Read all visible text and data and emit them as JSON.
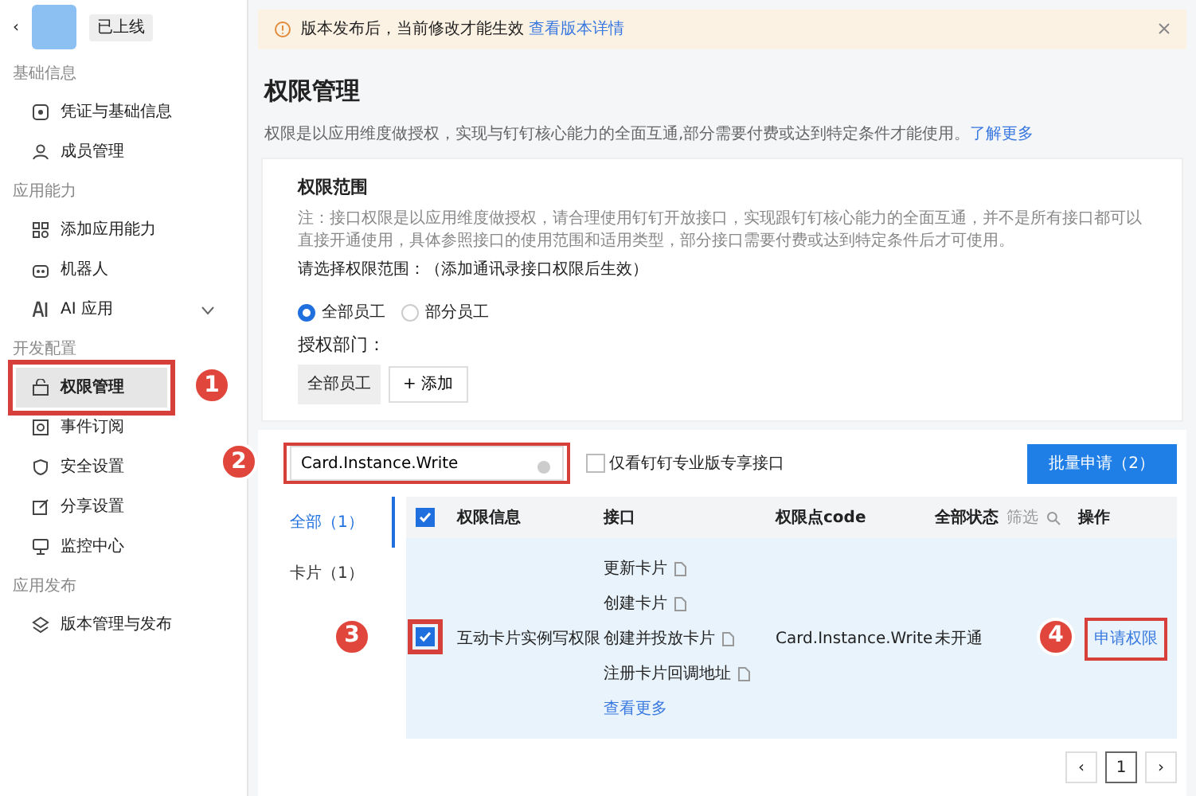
{
  "header": {
    "back": "‹",
    "status": "已上线"
  },
  "sidebar": {
    "sections": [
      {
        "title": "基础信息",
        "items": [
          {
            "label": "凭证与基础信息",
            "selected": false
          },
          {
            "label": "成员管理",
            "selected": false
          }
        ]
      },
      {
        "title": "应用能力",
        "items": [
          {
            "label": "添加应用能力",
            "selected": false
          },
          {
            "label": "机器人",
            "selected": false
          },
          {
            "label": "AI 应用",
            "selected": false,
            "expanded": false
          }
        ]
      },
      {
        "title": "开发配置",
        "items": [
          {
            "label": "权限管理",
            "selected": true,
            "callout": "1"
          },
          {
            "label": "事件订阅",
            "selected": false
          },
          {
            "label": "安全设置",
            "selected": false
          },
          {
            "label": "分享设置",
            "selected": false
          },
          {
            "label": "监控中心",
            "selected": false
          }
        ]
      },
      {
        "title": "应用发布",
        "items": [
          {
            "label": "版本管理与发布",
            "selected": false
          }
        ]
      }
    ]
  },
  "banner": {
    "text": "版本发布后，当前修改才能生效",
    "link": "查看版本详情"
  },
  "page": {
    "title": "权限管理",
    "description": "权限是以应用维度做授权，实现与钉钉核心能力的全面互通,部分需要付费或达到特定条件才能使用。",
    "link": "了解更多"
  },
  "scope": {
    "title": "权限范围",
    "note": "注：接口权限是以应用维度做授权，请合理使用钉钉开放接口，实现跟钉钉核心能力的全面互通，并不是所有接口都可以直接开通使用，具体参照接口的使用范围和适用类型，部分接口需要付费或达到特定条件后才可使用。",
    "prompt": "请选择权限范围：（添加通讯录接口权限后生效）",
    "radios": [
      {
        "label": "全部员工",
        "selected": true
      },
      {
        "label": "部分员工",
        "selected": false
      }
    ],
    "dept_label": "授权部门：",
    "dept_tags": [
      "全部员工"
    ],
    "add_button": "+ 添加"
  },
  "toolbar": {
    "search_value": "Card.Instance.Write",
    "search_callout": "2",
    "filter": {
      "label": "仅看钉钉专业版专享接口",
      "checked": false
    },
    "batch_button": "批量申请（2）"
  },
  "categories": [
    {
      "label": "全部（1）",
      "selected": true
    },
    {
      "label": "卡片（1）",
      "selected": false
    }
  ],
  "table": {
    "header_checked": true,
    "columns": [
      "权限信息",
      "接口",
      "权限点code",
      "全部状态",
      "操作"
    ],
    "filter_label": "筛选",
    "rows": [
      {
        "checked": true,
        "checkbox_callout": "3",
        "info": "互动卡片实例写权限",
        "apis": [
          "更新卡片",
          "创建卡片",
          "创建并投放卡片",
          "注册卡片回调地址"
        ],
        "more": "查看更多",
        "code": "Card.Instance.Write",
        "status": "未开通",
        "action": "申请权限",
        "action_callout": "4"
      }
    ]
  },
  "pagination": {
    "prev": "‹",
    "page": "1",
    "next": "›"
  }
}
